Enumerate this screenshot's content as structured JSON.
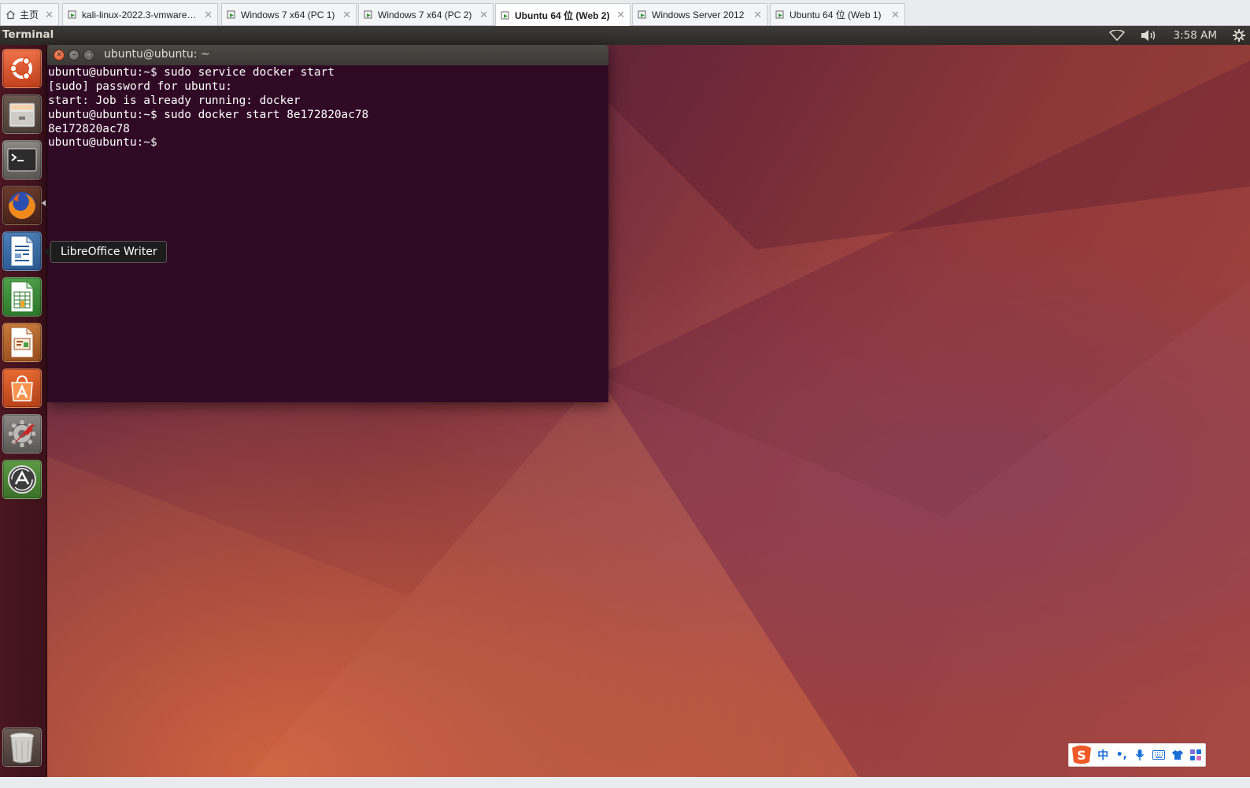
{
  "vmware_tabs": [
    {
      "label": "主页",
      "icon": "home-icon",
      "active": false
    },
    {
      "label": "kali-linux-2022.3-vmware-am...",
      "icon": "vm-icon",
      "active": false
    },
    {
      "label": "Windows 7 x64 (PC 1)",
      "icon": "vm-icon",
      "active": false
    },
    {
      "label": "Windows 7 x64 (PC 2)",
      "icon": "vm-icon",
      "active": false
    },
    {
      "label": "Ubuntu 64 位 (Web 2)",
      "icon": "vm-icon",
      "active": true
    },
    {
      "label": "Windows Server 2012",
      "icon": "vm-icon",
      "active": false
    },
    {
      "label": "Ubuntu 64 位 (Web 1)",
      "icon": "vm-icon",
      "active": false
    }
  ],
  "top_panel": {
    "app_name": "Terminal",
    "clock": "3:58 AM",
    "indicators": [
      "wifi-icon",
      "volume-icon",
      "gear-icon"
    ]
  },
  "launcher": {
    "items": [
      {
        "name": "dash-home",
        "icon": "ubuntu-logo-icon"
      },
      {
        "name": "files",
        "icon": "file-cabinet-icon"
      },
      {
        "name": "terminal",
        "icon": "terminal-icon",
        "running": true
      },
      {
        "name": "firefox",
        "icon": "firefox-icon"
      },
      {
        "name": "libreoffice-writer",
        "icon": "writer-icon"
      },
      {
        "name": "libreoffice-calc",
        "icon": "calc-icon"
      },
      {
        "name": "libreoffice-impress",
        "icon": "impress-icon"
      },
      {
        "name": "ubuntu-software",
        "icon": "software-center-icon"
      },
      {
        "name": "system-settings",
        "icon": "settings-icon"
      },
      {
        "name": "software-updater",
        "icon": "updater-icon"
      }
    ],
    "trash_icon": "trash-icon",
    "tooltip": "LibreOffice Writer"
  },
  "terminal": {
    "title": "ubuntu@ubuntu: ~",
    "lines": [
      "ubuntu@ubuntu:~$ sudo service docker start",
      "[sudo] password for ubuntu:",
      "start: Job is already running: docker",
      "ubuntu@ubuntu:~$ sudo docker start 8e172820ac78",
      "8e172820ac78",
      "ubuntu@ubuntu:~$ "
    ],
    "background": "#300a24"
  },
  "ime_toolbar": {
    "logo_icon": "sogou-logo-icon",
    "mode": "中",
    "punct": "•,",
    "icons": [
      "microphone-icon",
      "keyboard-icon",
      "shirt-icon",
      "apps-grid-icon"
    ]
  },
  "colors": {
    "terminal_bg": "#300a24",
    "panel_bg": "#3c3b37",
    "accent": "#e95420"
  }
}
